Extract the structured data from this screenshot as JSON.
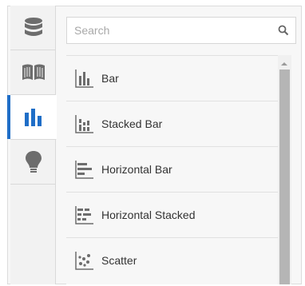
{
  "colors": {
    "accent": "#1f6ec7",
    "icon_gray": "#6d6d6d",
    "active_icon": "#1f6ec7"
  },
  "rail": {
    "tabs": [
      {
        "icon": "database-icon",
        "active": false
      },
      {
        "icon": "book-icon",
        "active": false
      },
      {
        "icon": "bar-chart-icon",
        "active": true
      },
      {
        "icon": "lightbulb-icon",
        "active": false
      }
    ]
  },
  "search": {
    "placeholder": "Search",
    "value": "",
    "icon": "search-icon"
  },
  "chart_types": [
    {
      "label": "Bar",
      "icon": "bar-chart-type-icon"
    },
    {
      "label": "Stacked Bar",
      "icon": "stacked-bar-chart-type-icon"
    },
    {
      "label": "Horizontal Bar",
      "icon": "horizontal-bar-chart-type-icon"
    },
    {
      "label": "Horizontal Stacked",
      "icon": "horizontal-stacked-chart-type-icon"
    },
    {
      "label": "Scatter",
      "icon": "scatter-chart-type-icon"
    }
  ]
}
